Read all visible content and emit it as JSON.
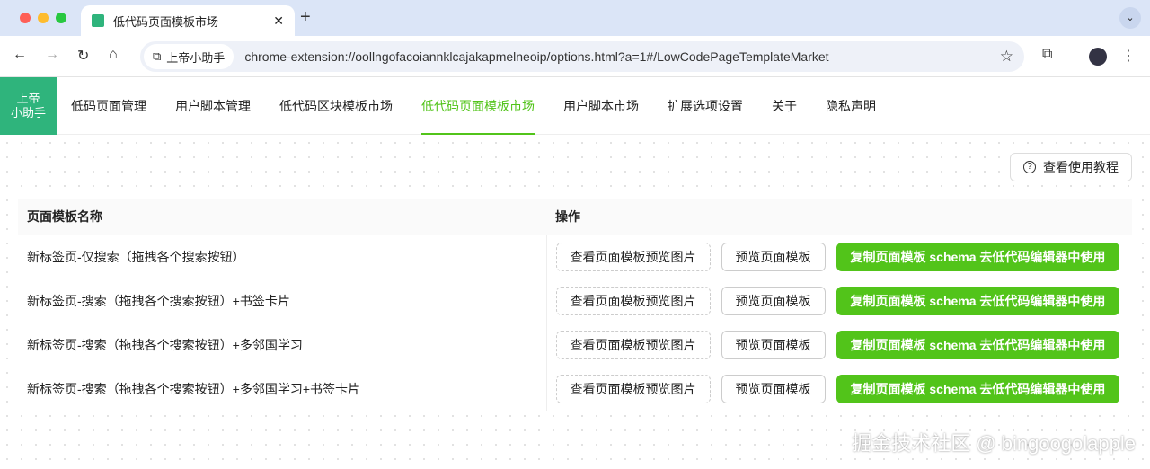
{
  "browser": {
    "tab_title": "低代码页面模板市场",
    "site_chip": "上帝小助手",
    "url": "chrome-extension://oollngofacoiannklcajakapmelneoip/options.html?a=1#/LowCodePageTemplateMarket"
  },
  "logo": {
    "line1": "上帝",
    "line2": "小助手"
  },
  "nav": [
    "低码页面管理",
    "用户脚本管理",
    "低代码区块模板市场",
    "低代码页面模板市场",
    "用户脚本市场",
    "扩展选项设置",
    "关于",
    "隐私声明"
  ],
  "help_button": "查看使用教程",
  "table": {
    "headers": [
      "页面模板名称",
      "操作"
    ],
    "rows": [
      "新标签页-仅搜索（拖拽各个搜索按钮）",
      "新标签页-搜索（拖拽各个搜索按钮）+书签卡片",
      "新标签页-搜索（拖拽各个搜索按钮）+多邻国学习",
      "新标签页-搜索（拖拽各个搜索按钮）+多邻国学习+书签卡片"
    ],
    "actions": {
      "view_image": "查看页面模板预览图片",
      "preview": "预览页面模板",
      "copy": "复制页面模板 schema 去低代码编辑器中使用"
    }
  },
  "watermark": "掘金技术社区 @ bingoogolapple"
}
